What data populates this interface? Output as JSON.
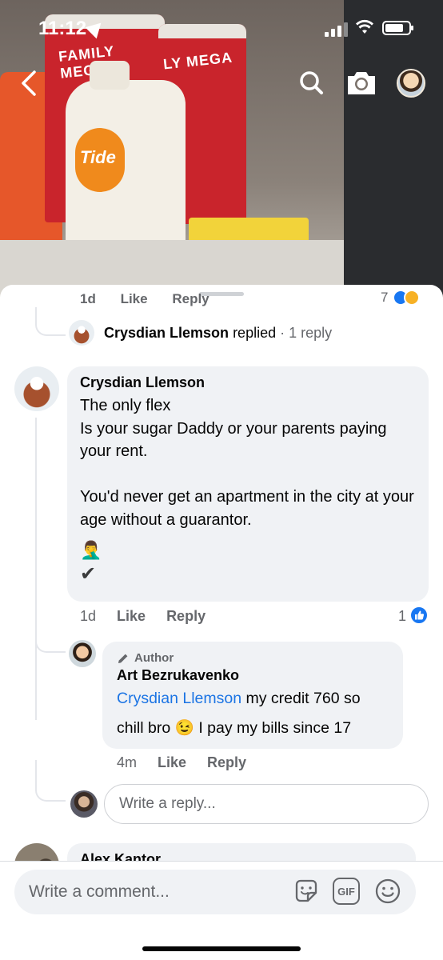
{
  "status_bar": {
    "time": "11:12"
  },
  "background_photo": {
    "roll_left_text": "FAMILY MEGA",
    "roll_right_text": "LY MEGA",
    "jug_text": "Tide"
  },
  "nav": {
    "back_icon": "chevron-left-icon",
    "search_icon": "search-icon",
    "camera_icon": "camera-icon"
  },
  "top_cut_comment": {
    "time": "1d",
    "like_label": "Like",
    "reply_label": "Reply",
    "reaction_count": "7"
  },
  "replied_row": {
    "name": "Crysdian Llemson",
    "action": "replied",
    "separator": "·",
    "count": "1 reply"
  },
  "main_comment": {
    "author": "Crysdian Llemson",
    "text": "The only flex\nIs your sugar Daddy or your parents paying your rent.\n\nYou'd never get an apartment in the city at your age without a guarantor.",
    "extra_emoji": "🤦‍♂️",
    "check_mark": "✔",
    "time": "1d",
    "like_label": "Like",
    "reply_label": "Reply",
    "like_count": "1"
  },
  "author_reply": {
    "badge_label": "Author",
    "author": "Art Bezrukavenko",
    "mention": "Crysdian Llemson",
    "text_before_emoji": " my credit 760 so chill bro ",
    "emoji": "😉",
    "text_after_emoji": " I pay my bills since 17",
    "time": "4m",
    "like_label": "Like",
    "reply_label": "Reply"
  },
  "reply_box": {
    "placeholder": "Write a reply..."
  },
  "next_comment": {
    "author": "Alex Kantor"
  },
  "composer": {
    "placeholder": "Write a comment...",
    "gif_label": "GIF"
  },
  "colors": {
    "accent_blue": "#1877f2",
    "bubble_gray": "#f0f2f5",
    "secondary_text": "#65676b"
  }
}
